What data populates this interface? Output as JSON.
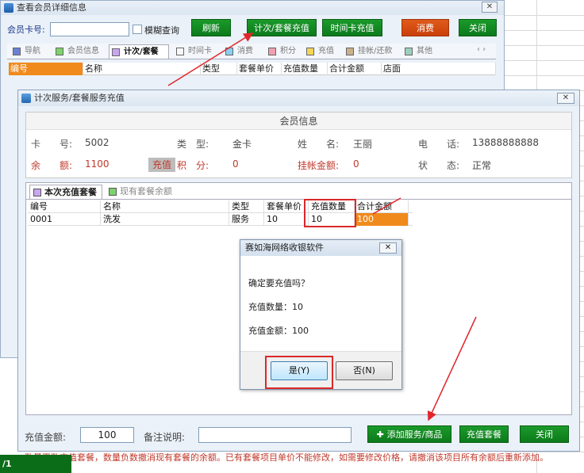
{
  "bg_window": {
    "title": "查看会员详细信息",
    "card_label": "会员卡号:",
    "fuzzy_label": "模糊查询",
    "buttons": {
      "refresh": "刷新",
      "count_recharge": "计次/套餐充值",
      "time_card_recharge": "时间卡充值",
      "consume": "消费",
      "close": "关闭"
    },
    "tabs": [
      {
        "label": "导航",
        "color": "#6a7fd8"
      },
      {
        "label": "会员信息",
        "color": "#7cd36b"
      },
      {
        "label": "计次/套餐",
        "color": "#c8a6ef"
      },
      {
        "label": "时间卡",
        "color": "#f7f7f7"
      },
      {
        "label": "消费",
        "color": "#8ad0f0"
      },
      {
        "label": "积分",
        "color": "#f0a0b0"
      },
      {
        "label": "充值",
        "color": "#f6d45a"
      },
      {
        "label": "挂帐/还款",
        "color": "#c8b08a"
      },
      {
        "label": "其他",
        "color": "#9ccfc0"
      }
    ],
    "grid_headers": [
      "编号",
      "名称",
      "类型",
      "套餐单价",
      "充值数量",
      "合计金额",
      "店面"
    ]
  },
  "dialog": {
    "title": "计次服务/套餐服务充值",
    "member_info_header": "会员信息",
    "card_no_label": "卡　　号:",
    "card_no": "5002",
    "type_label": "类　型:",
    "type": "金卡",
    "name_label": "姓　　名:",
    "name": "王丽",
    "phone_label": "电　　话:",
    "phone": "13888888888",
    "balance_label": "余　　额:",
    "balance": "1100",
    "recharge_chip": "充值",
    "points_label": "积　分:",
    "points": "0",
    "credit_label": "挂帐金额:",
    "credit": "0",
    "status_label": "状　　态:",
    "status": "正常",
    "tabs": [
      {
        "label": "本次充值套餐",
        "color": "#c8a6ef"
      },
      {
        "label": "现有套餐余额",
        "color": "#7cd36b"
      }
    ],
    "grid_headers": [
      "编号",
      "名称",
      "类型",
      "套餐单价",
      "充值数量",
      "合计金额"
    ],
    "grid_rows": [
      [
        "0001",
        "洗发",
        "服务",
        "10",
        "10",
        "100"
      ]
    ],
    "amount_label": "充值金额:",
    "amount_value": "100",
    "remark_label": "备注说明:",
    "remark_value": "",
    "buttons": {
      "add": "添加服务/商品",
      "recharge_package": "充值套餐",
      "close": "关闭"
    },
    "note": "数量正数充值套餐，数量负数撤消现有套餐的余额。已有套餐项目单价不能修改，如需要修改价格，请撤消该项目所有余额后重新添加。"
  },
  "msgbox": {
    "title": "赛如海网络收银软件",
    "line1": "确定要充值吗？",
    "line2": "充值数量：10",
    "line3": "充值金额：100",
    "yes": "是(Y)",
    "no": "否(N)"
  },
  "statusbar": {
    "text": "/1"
  }
}
